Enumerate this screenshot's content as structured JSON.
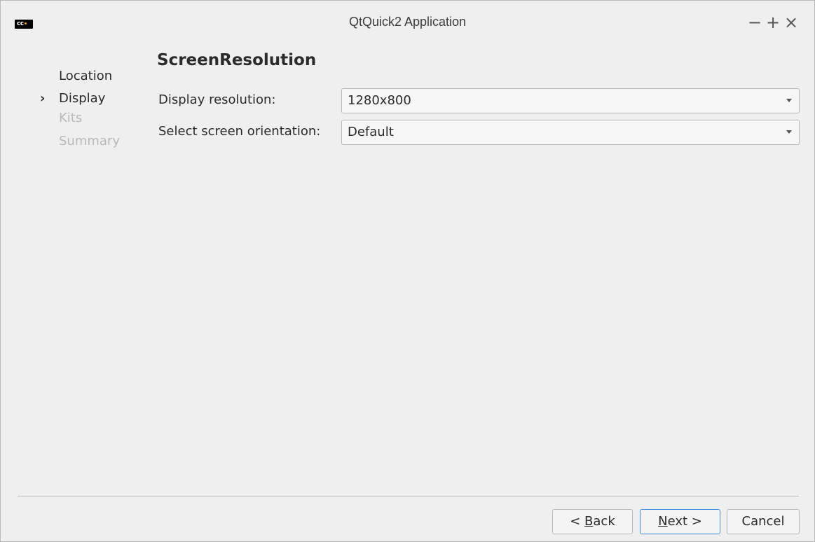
{
  "window": {
    "title": "QtQuick2 Application",
    "app_icon_text": "cc",
    "controls": {
      "minimize": "−",
      "maximize": "+",
      "close": "×"
    }
  },
  "sidebar": {
    "steps": [
      {
        "label": "Location",
        "state": "done",
        "marker": ""
      },
      {
        "label": "Display",
        "state": "current",
        "marker": "›"
      },
      {
        "label": "Kits",
        "state": "todo",
        "marker": ""
      },
      {
        "label": "Summary",
        "state": "todo",
        "marker": ""
      }
    ]
  },
  "page": {
    "heading": "ScreenResolution",
    "fields": {
      "resolution": {
        "label": "Display resolution:",
        "value": "1280x800"
      },
      "orientation": {
        "label": "Select screen orientation:",
        "value": "Default"
      }
    }
  },
  "footer": {
    "back_pre": "< ",
    "back_mnemonic": "B",
    "back_post": "ack",
    "next_mnemonic": "N",
    "next_post": "ext >",
    "cancel": "Cancel"
  },
  "colors": {
    "accent": "#3d8be0",
    "background": "#efefef",
    "disabled_text": "#b9b9b9"
  }
}
